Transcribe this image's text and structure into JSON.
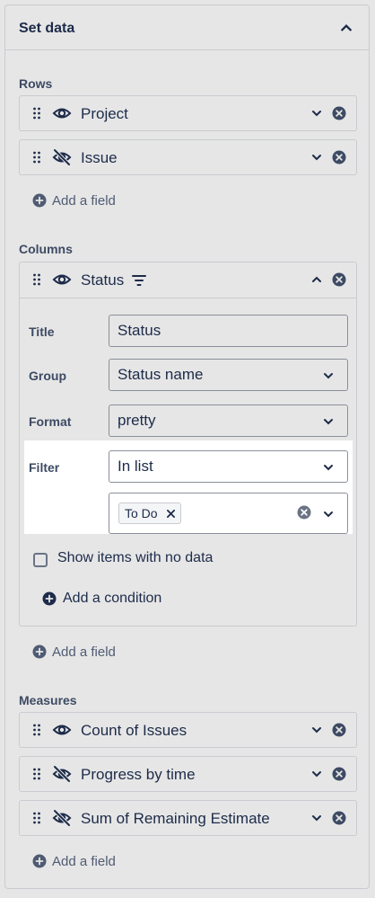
{
  "panel": {
    "title": "Set data"
  },
  "rows": {
    "label": "Rows",
    "fields": [
      {
        "label": "Project",
        "visible": true
      },
      {
        "label": "Issue",
        "visible": false
      }
    ],
    "add_label": "Add a field"
  },
  "columns": {
    "label": "Columns",
    "expanded_field": {
      "label": "Status",
      "title_label": "Title",
      "title_value": "Status",
      "group_label": "Group",
      "group_value": "Status name",
      "format_label": "Format",
      "format_value": "pretty",
      "filter_label": "Filter",
      "filter_value": "In list",
      "filter_tags": [
        "To Do"
      ],
      "show_no_data_label": "Show items with no data",
      "show_no_data_checked": false,
      "add_condition_label": "Add a condition"
    },
    "add_label": "Add a field"
  },
  "measures": {
    "label": "Measures",
    "fields": [
      {
        "label": "Count of Issues",
        "visible": true
      },
      {
        "label": "Progress by time",
        "visible": false
      },
      {
        "label": "Sum of Remaining Estimate",
        "visible": false
      }
    ],
    "add_label": "Add a field"
  },
  "colors": {
    "text": "#1d2b4a",
    "border": "#c8cbd0",
    "background": "#e6e6e6",
    "highlight": "#ffffff"
  }
}
